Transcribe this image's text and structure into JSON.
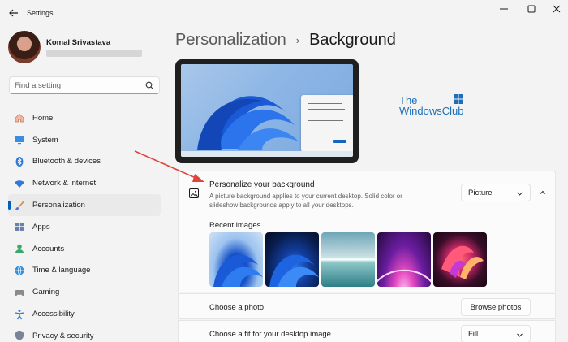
{
  "window": {
    "app_title": "Settings"
  },
  "profile": {
    "name": "Komal Srivastava"
  },
  "search": {
    "placeholder": "Find a setting"
  },
  "nav": {
    "items": [
      {
        "label": "Home",
        "icon": "home-icon"
      },
      {
        "label": "System",
        "icon": "system-icon"
      },
      {
        "label": "Bluetooth & devices",
        "icon": "bluetooth-icon"
      },
      {
        "label": "Network & internet",
        "icon": "wifi-icon"
      },
      {
        "label": "Personalization",
        "icon": "brush-icon",
        "active": true
      },
      {
        "label": "Apps",
        "icon": "apps-icon"
      },
      {
        "label": "Accounts",
        "icon": "accounts-icon"
      },
      {
        "label": "Time & language",
        "icon": "globe-icon"
      },
      {
        "label": "Gaming",
        "icon": "gaming-icon"
      },
      {
        "label": "Accessibility",
        "icon": "accessibility-icon"
      },
      {
        "label": "Privacy & security",
        "icon": "shield-icon"
      }
    ]
  },
  "breadcrumb": {
    "parent": "Personalization",
    "separator": "›",
    "current": "Background"
  },
  "watermark": {
    "line1": "The",
    "line2": "WindowsClub"
  },
  "personalize": {
    "title": "Personalize your background",
    "description": "A picture background applies to your current desktop. Solid color or slideshow backgrounds apply to all your desktops.",
    "dropdown_value": "Picture"
  },
  "recent": {
    "label": "Recent images",
    "count": 5
  },
  "choose_photo": {
    "label": "Choose a photo",
    "button": "Browse photos"
  },
  "choose_fit": {
    "label": "Choose a fit for your desktop image",
    "dropdown_value": "Fill"
  },
  "colors": {
    "accent": "#005fb8",
    "annotation_arrow": "#e0443a",
    "watermark": "#1d6fb8"
  }
}
